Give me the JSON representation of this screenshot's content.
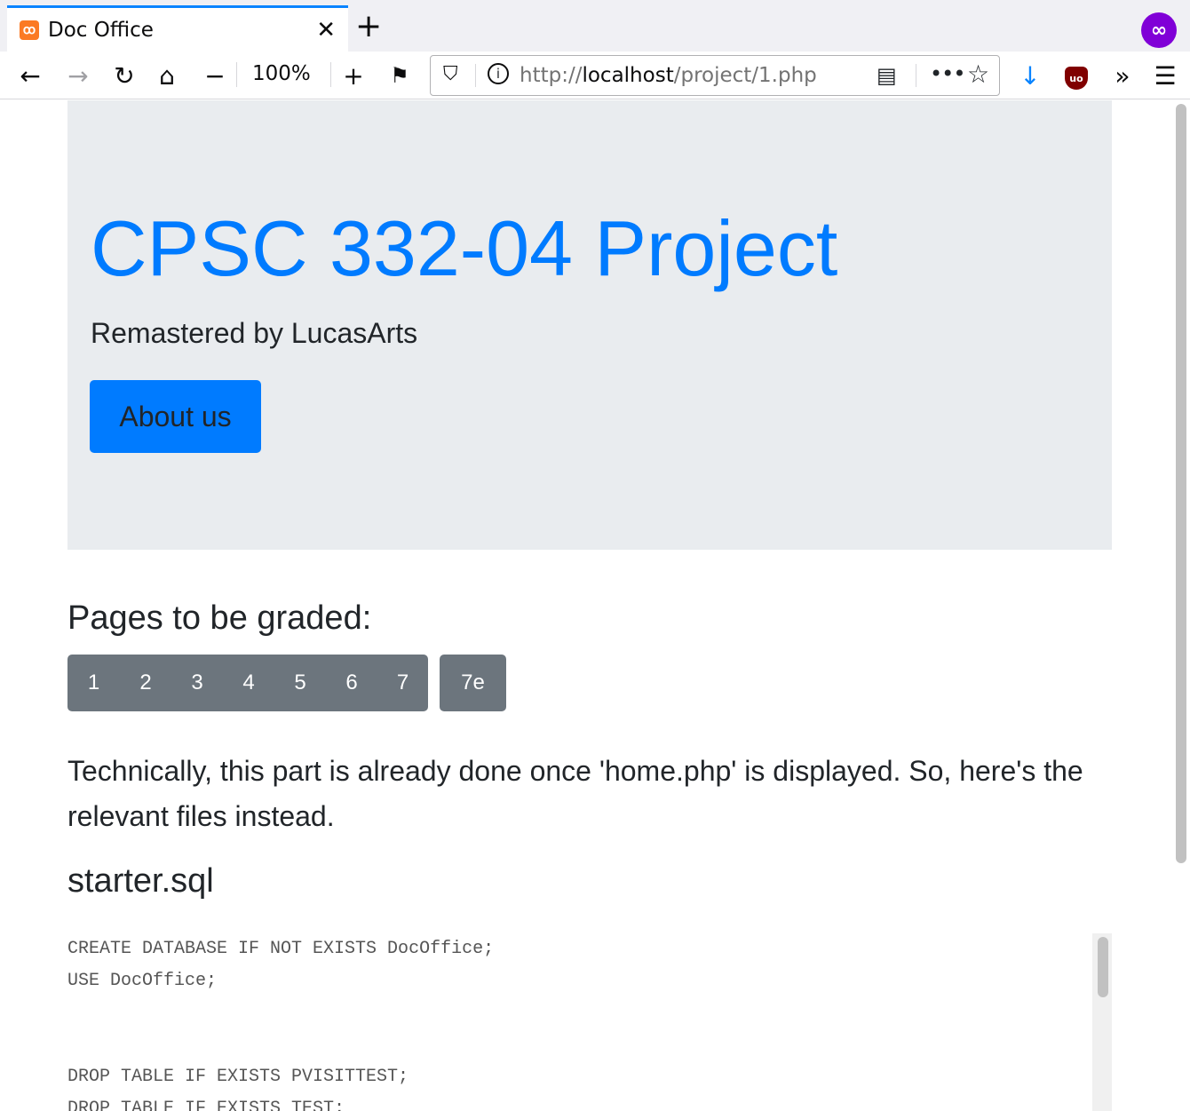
{
  "browser": {
    "tab": {
      "title": "Doc Office",
      "favicon": "xampp-icon",
      "close": "✕"
    },
    "new_tab": "+",
    "nav": {
      "back": "←",
      "forward": "→",
      "reload": "↻",
      "home": "⌂",
      "zoom_out": "−",
      "zoom_level": "100%",
      "zoom_in": "+",
      "screenshot": "⚑",
      "more": "•••",
      "bookmark": "☆",
      "download": "↓",
      "ublock": "uo",
      "overflow": "»",
      "menu": "☰"
    },
    "url": {
      "scheme": "http://",
      "host": "localhost",
      "path": "/project/1.php"
    },
    "private_badge": "∞"
  },
  "jumbotron": {
    "title": "CPSC 332-04 Project",
    "subtitle": "Remastered by LucasArts",
    "button": "About us"
  },
  "pages_section": {
    "heading": "Pages to be graded:",
    "buttons": [
      "1",
      "2",
      "3",
      "4",
      "5",
      "6",
      "7"
    ],
    "extra_button": "7e"
  },
  "description": "Technically, this part is already done once 'home.php' is displayed. So, here's the relevant files instead.",
  "file_section": {
    "heading": "starter.sql",
    "code_lines": [
      "CREATE DATABASE IF NOT EXISTS DocOffice;",
      "USE DocOffice;",
      "",
      "",
      "DROP TABLE IF EXISTS PVISITTEST;",
      "DROP TABLE IF EXISTS TEST;"
    ]
  }
}
